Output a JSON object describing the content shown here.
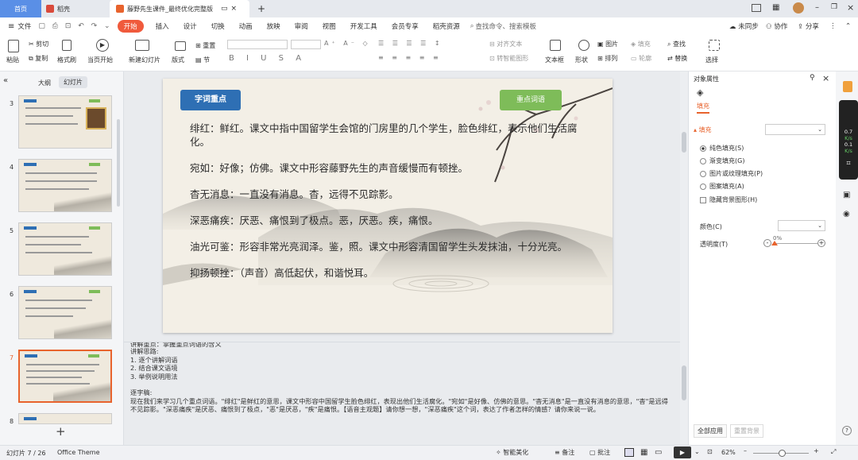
{
  "tabs": {
    "home": "首页",
    "draft": "稻壳",
    "document": "藤野先生课件_最终优化完整版"
  },
  "menu": [
    "文件",
    "开始",
    "插入",
    "设计",
    "切换",
    "动画",
    "放映",
    "审阅",
    "视图",
    "开发工具",
    "会员专享",
    "稻壳资源"
  ],
  "menu_search": "查找命令、搜索模板",
  "menu_right": {
    "unsynced": "未同步",
    "collab": "协作",
    "share": "分享"
  },
  "ribbon": {
    "cut": "剪切",
    "paste": "粘贴",
    "copy": "复制",
    "format_painter": "格式刷",
    "play_from_current": "当页开始",
    "new_slide": "新建幻灯片",
    "layout": "版式",
    "section": "节",
    "reset": "重置",
    "align_text": "对齐文本",
    "smart_graphic": "转智能图形",
    "textbox": "文本框",
    "shape": "形状",
    "picture": "图片",
    "arrange": "排列",
    "fill": "填充",
    "outline": "轮廓",
    "find": "查找",
    "replace": "替换",
    "select": "选择"
  },
  "left_panel": {
    "tab_outline": "大纲",
    "tab_slides": "幻灯片",
    "slide_numbers": [
      "3",
      "4",
      "5",
      "6",
      "7",
      "8"
    ],
    "add": "+"
  },
  "slide": {
    "left_button": "字词重点",
    "right_button": "重点词语",
    "lines": [
      "绯红：鲜红。课文中指中国留学生会馆的门房里的几个学生，脸色绯红，表示他们生活腐化。",
      "宛如：好像；仿佛。课文中形容藤野先生的声音缓慢而有顿挫。",
      "杳无消息：一直没有消息。杳，远得不见踪影。",
      "深恶痛疾：厌恶、痛恨到了极点。恶，厌恶。疾，痛恨。",
      "油光可鉴：形容非常光亮润泽。鉴，照。课文中形容清国留学生头发抹油，十分光亮。",
      "抑扬顿挫：（声音）高低起伏，和谐悦耳。"
    ]
  },
  "notes": {
    "lines": [
      "讲解重点：掌握重点词语的含义",
      "讲解思路:",
      "1. 逐个讲解词语",
      "2. 结合课文语境",
      "3. 举例说明用法",
      "",
      "逐字稿:",
      "现在我们来学习几个重点词语。\"绯红\"是鲜红的意思，课文中形容中国留学生脸色绯红，表现出他们生活腐化。\"宛如\"是好像、仿佛的意思。\"杳无消息\"是一直没有消息的意思，\"杳\"是远得不见踪影。\"深恶痛疾\"是厌恶、痛恨到了极点，\"恶\"是厌恶，\"疾\"是痛恨。【语音主观题】请你想一想，\"深恶痛疾\"这个词，表达了作者怎样的情感？请你来说一说。"
    ]
  },
  "right_panel": {
    "title": "对象属性",
    "fill_tab": "填充",
    "fill_section": "填充",
    "options": [
      "纯色填充(S)",
      "渐变填充(G)",
      "图片或纹理填充(P)",
      "图案填充(A)"
    ],
    "hide_bg": "隐藏背景图形(H)",
    "color_label": "颜色(C)",
    "transparency_label": "透明度(T)",
    "transparency_value": "0%",
    "apply_all": "全部应用",
    "reset_bg": "重置背景"
  },
  "side_widgets": {
    "speed1": "0.7",
    "unit1": "K/s",
    "speed2": "0.1",
    "unit2": "K/s"
  },
  "status": {
    "slide_indicator": "幻灯片 7 / 26",
    "theme": "Office Theme",
    "beautify": "智能美化",
    "notes": "备注",
    "comments": "批注",
    "zoom": "62%"
  },
  "colors": {
    "accent": "#f05a3c",
    "slide_blue_button": "#2e6fb4",
    "slide_green_button": "#7ebc59",
    "selected_thumb_border": "#e8632d"
  }
}
